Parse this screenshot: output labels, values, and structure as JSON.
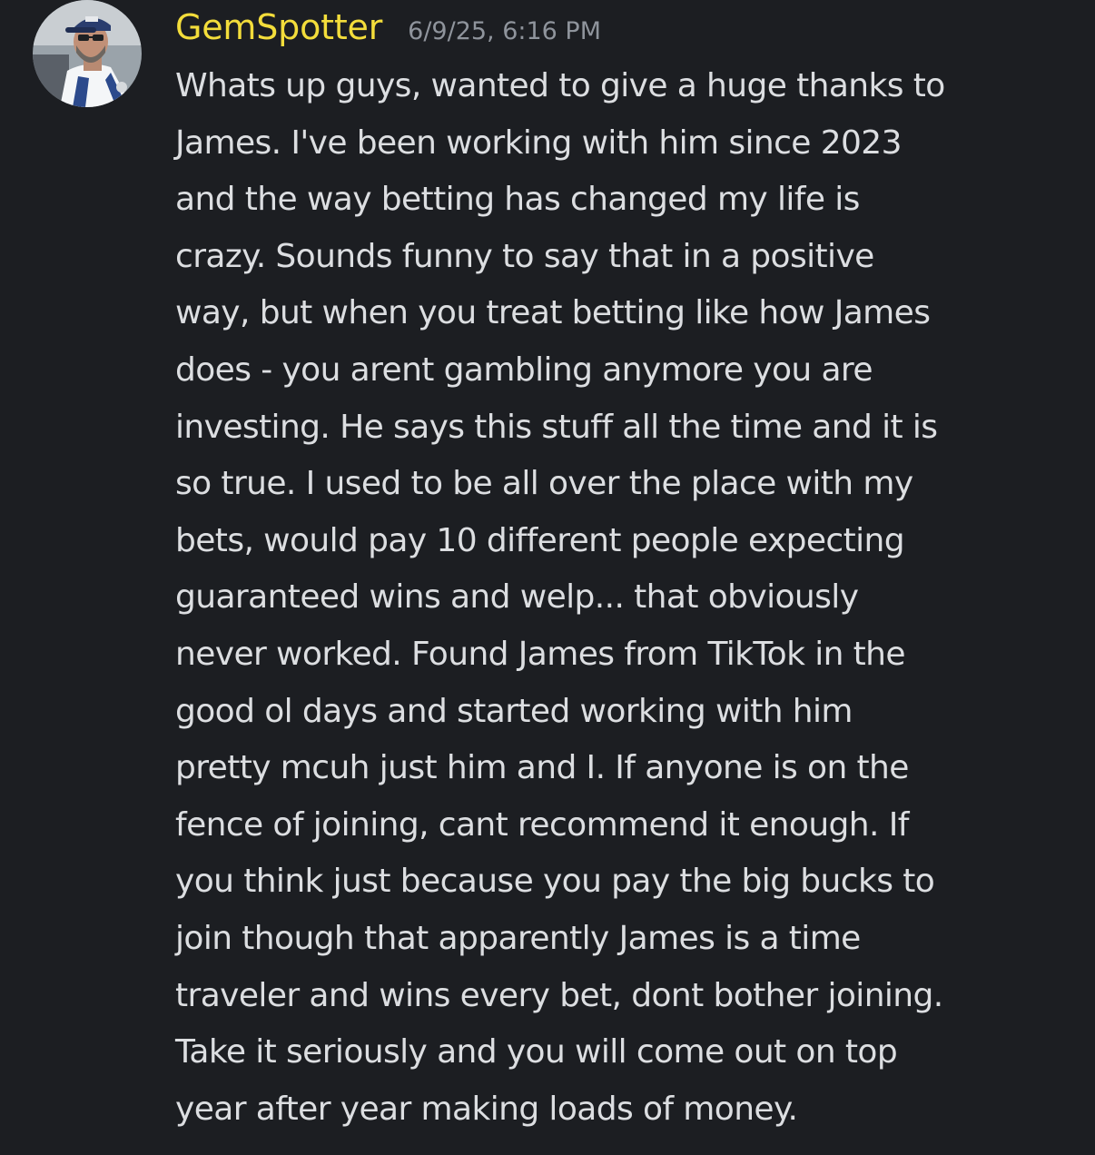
{
  "message": {
    "author": "GemSpotter",
    "timestamp": "6/9/25, 6:16 PM",
    "lines": [
      "Whats up guys, wanted to give a huge thanks to",
      "James. I've been working with him since 2023",
      "and the way betting has changed my life is",
      "crazy. Sounds funny to say that in a positive",
      "way, but when you treat betting like how James",
      "does - you arent gambling anymore you are",
      "investing. He says this stuff all the time and it is",
      "so true. I used to be all over the place with my",
      "bets, would pay 10 different people expecting",
      "guaranteed wins and welp... that obviously",
      "never worked. Found James from TikTok in the",
      "good ol days and started working with him",
      "pretty mcuh just him and I. If anyone is on the",
      "fence of joining, cant recommend it enough. If",
      "you think just because you pay the big bucks to",
      "join though that apparently James is a time",
      "traveler and wins every bet, dont bother joining.",
      "Take it seriously and you will come out on top",
      "year after year making loads of money."
    ]
  },
  "colors": {
    "background": "#1c1e22",
    "username": "#f3dd3b",
    "timestamp": "#8f949c",
    "text": "#dcdee1"
  }
}
